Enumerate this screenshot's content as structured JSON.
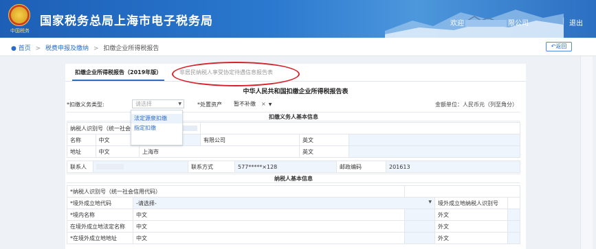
{
  "header": {
    "site_title": "国家税务总局上海市电子税务局",
    "emblem_text": "中国税务",
    "welcome": "欢迎",
    "company_suffix": "限公司",
    "separator": "|",
    "logout": "退出"
  },
  "breadcrumb": {
    "home": "首页",
    "level1": "税费申报及缴纳",
    "current": "扣缴企业所得税报告",
    "back": "返回"
  },
  "tabs": [
    {
      "label": "扣缴企业所得税报告（2019年版）"
    },
    {
      "label": "非居民纳税人享受协定待遇信息报告表"
    }
  ],
  "form": {
    "title": "中华人民共和国扣缴企业所得税报告表",
    "obligation_label": "*扣缴义务类型:",
    "obligation_placeholder": "请选择",
    "asset_label": "*处置资产",
    "asset_value": "暂不补缴",
    "unit": "金额单位：人民币元（列至角分）",
    "dropdown_options": [
      "法定源泉扣缴",
      "指定扣缴"
    ]
  },
  "section_withholder": {
    "heading": "扣缴义务人基本信息",
    "taxpayer_id_label": "纳税人识别号（统一社会信",
    "name_label": "名称",
    "name_cn": "中文",
    "name_value": "有限公司",
    "name_en": "英文",
    "addr_label": "地址",
    "addr_cn": "中文",
    "addr_value": "上海市",
    "addr_en": "英文",
    "contact_label": "联系人",
    "phone_label": "联系方式",
    "phone_value": "577*****×128",
    "postcode_label": "邮政编码",
    "postcode_value": "201613"
  },
  "section_taxpayer": {
    "heading": "纳税人基本信息",
    "taxpayer_id_label": "*纳税人识别号（统一社会信用代码）",
    "country_label": "*境外成立地代码",
    "country_placeholder": "-请选择-",
    "foreign_id_label": "境外成立地纳税人识别号",
    "domestic_name_label": "*境内名称",
    "domestic_name_cn": "中文",
    "domestic_name_foreign": "外文",
    "foreign_name_label": "在境外成立地法定名称",
    "foreign_name_cn": "中文",
    "foreign_name_foreign": "外文",
    "foreign_addr_label": "*在境外成立地地址",
    "foreign_addr_cn": "中文",
    "foreign_addr_foreign": "外文"
  }
}
